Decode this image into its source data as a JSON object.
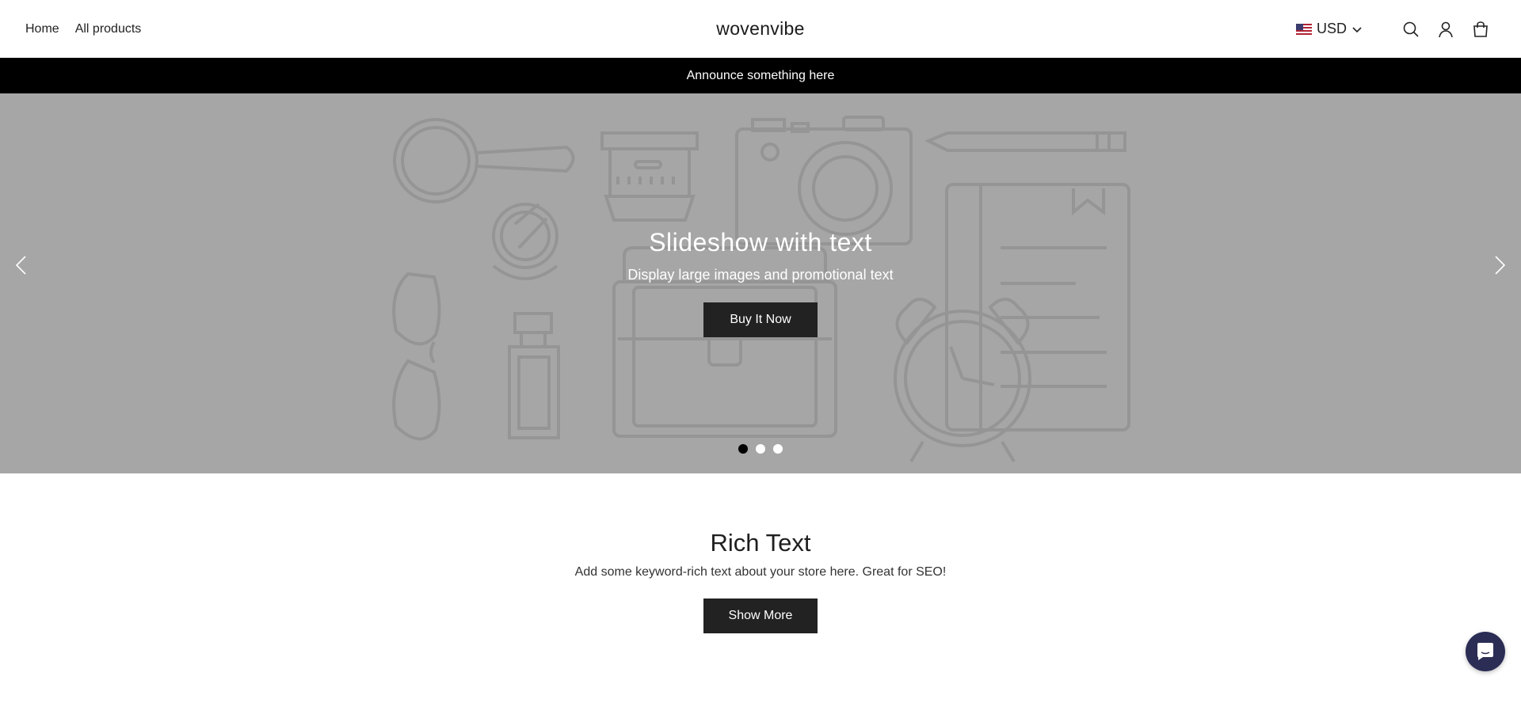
{
  "nav": {
    "home": "Home",
    "all_products": "All products"
  },
  "brand": {
    "logo_text": "wovenvibe"
  },
  "header": {
    "currency": "USD",
    "icons": [
      "search-icon",
      "account-icon",
      "cart-icon"
    ]
  },
  "announcement": {
    "text": "Announce something here"
  },
  "slideshow": {
    "title": "Slideshow with text",
    "subtitle": "Display large images and promotional text",
    "button_label": "Buy It Now",
    "slide_count": 3,
    "active_slide": 1
  },
  "rich_text": {
    "title": "Rich Text",
    "body": "Add some keyword-rich text about your store here. Great for SEO!",
    "button_label": "Show More"
  },
  "colors": {
    "announcement_bg": "#000000",
    "hero_bg": "#a6a6a6",
    "button_bg": "#222222",
    "chat_bg": "#2b2d55"
  }
}
